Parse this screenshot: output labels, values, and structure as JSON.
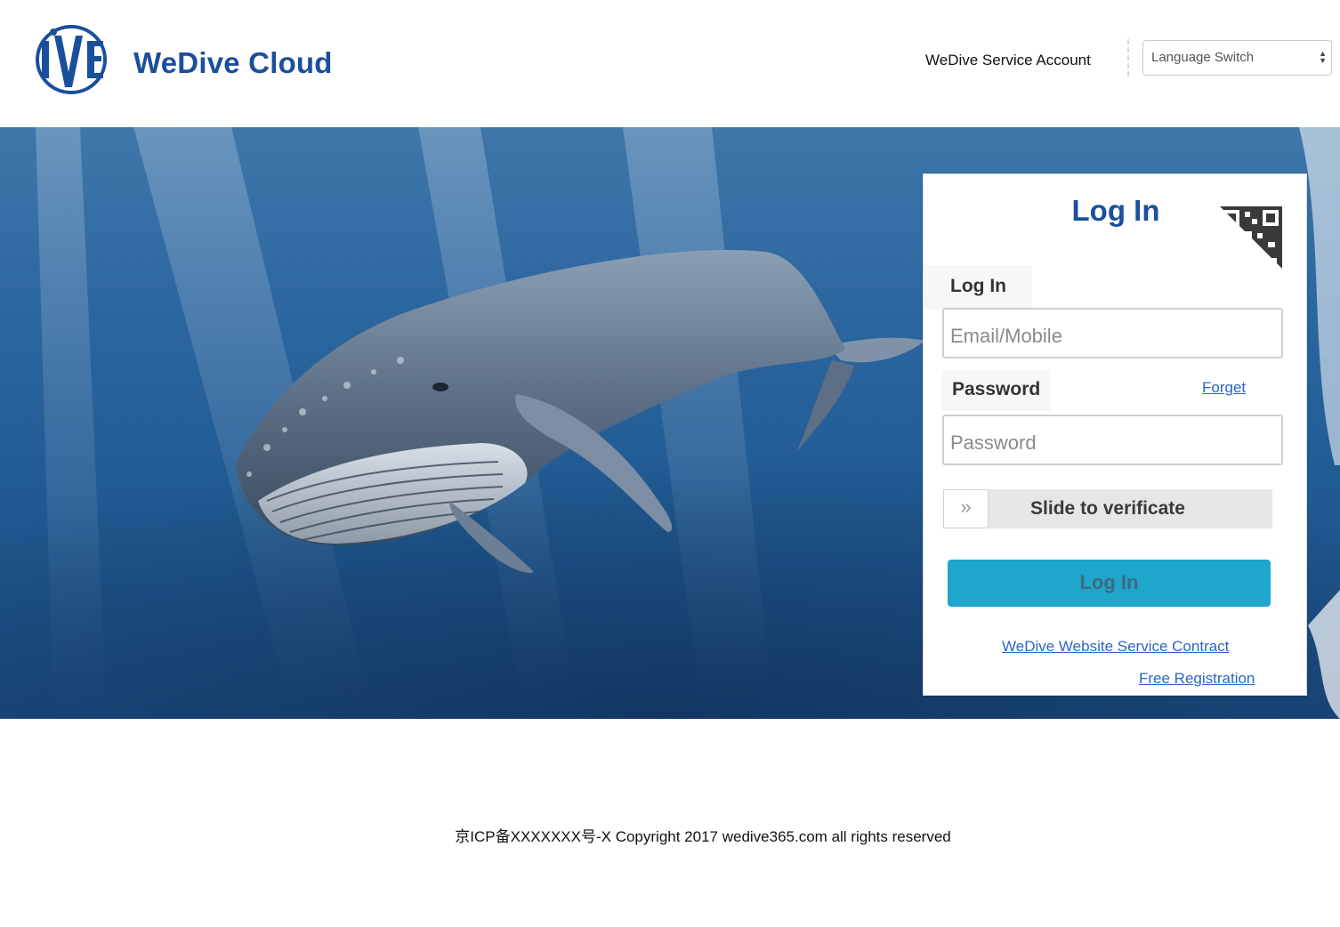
{
  "header": {
    "brand": "WeDive Cloud",
    "service_account_link": "WeDive Service Account",
    "language_select": {
      "selected": "Language Switch"
    }
  },
  "login_card": {
    "title": "Log In",
    "login_label": "Log In",
    "email_input": {
      "value": "",
      "placeholder": "Email/Mobile"
    },
    "password_label": "Password",
    "forget_link": "Forget",
    "password_input": {
      "value": "",
      "placeholder": "Password"
    },
    "slider": {
      "handle_glyph": "»",
      "text": "Slide to verificate"
    },
    "submit_label": "Log In",
    "contract_link": "WeDive Website Service Contract",
    "register_link": "Free Registration"
  },
  "footer": {
    "copyright": "京ICP备XXXXXXX号-X Copyright 2017 wedive365.com all rights reserved"
  },
  "colors": {
    "brand_blue": "#1a4f9c",
    "button_cyan": "#1ea6cc",
    "link_blue": "#2d63c8"
  },
  "icons": [
    "wedive-logo-icon",
    "qr-code-icon",
    "chevron-double-right-icon",
    "select-arrows-icon"
  ]
}
